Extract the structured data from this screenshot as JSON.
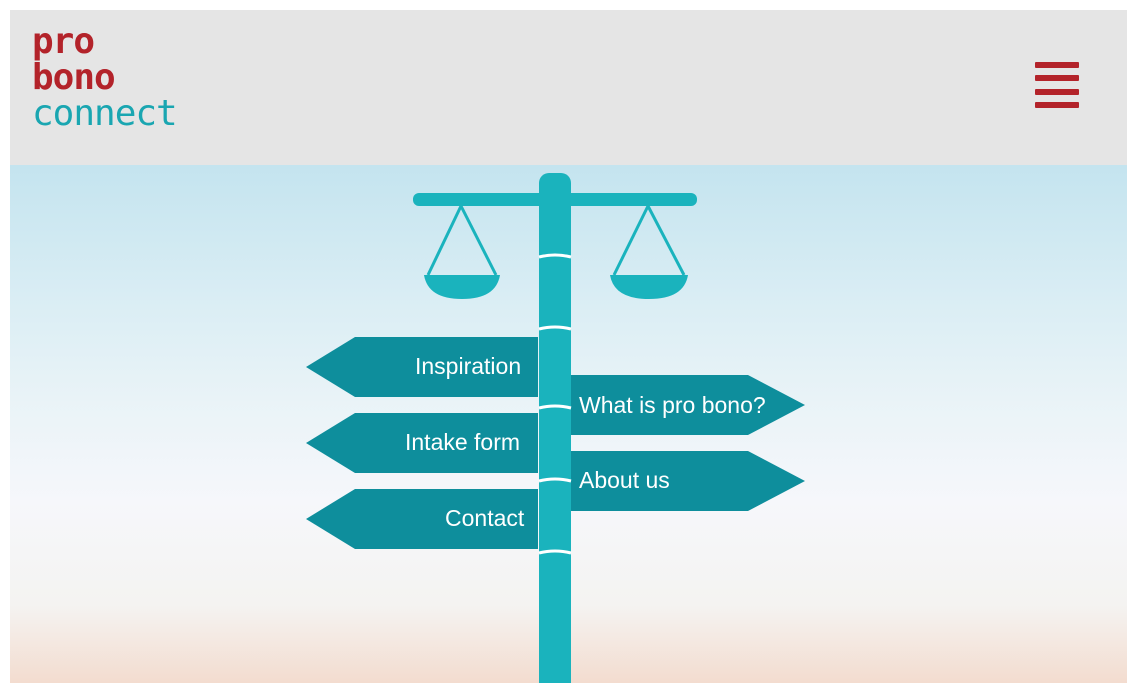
{
  "brand": {
    "logo_line1": "pro",
    "logo_line2": "bono",
    "logo_line3": "connect"
  },
  "header": {
    "menu_icon": "hamburger-menu-icon"
  },
  "signpost": {
    "left_signs": [
      {
        "label": "Inspiration"
      },
      {
        "label": "Intake form"
      },
      {
        "label": "Contact"
      }
    ],
    "right_signs": [
      {
        "label": "What is pro bono?"
      },
      {
        "label": "About us"
      }
    ],
    "icon": "scales-of-justice-icon"
  },
  "colors": {
    "brand_red": "#b3232a",
    "brand_teal": "#1aa6b1",
    "sign_teal": "#0e8e9c"
  }
}
